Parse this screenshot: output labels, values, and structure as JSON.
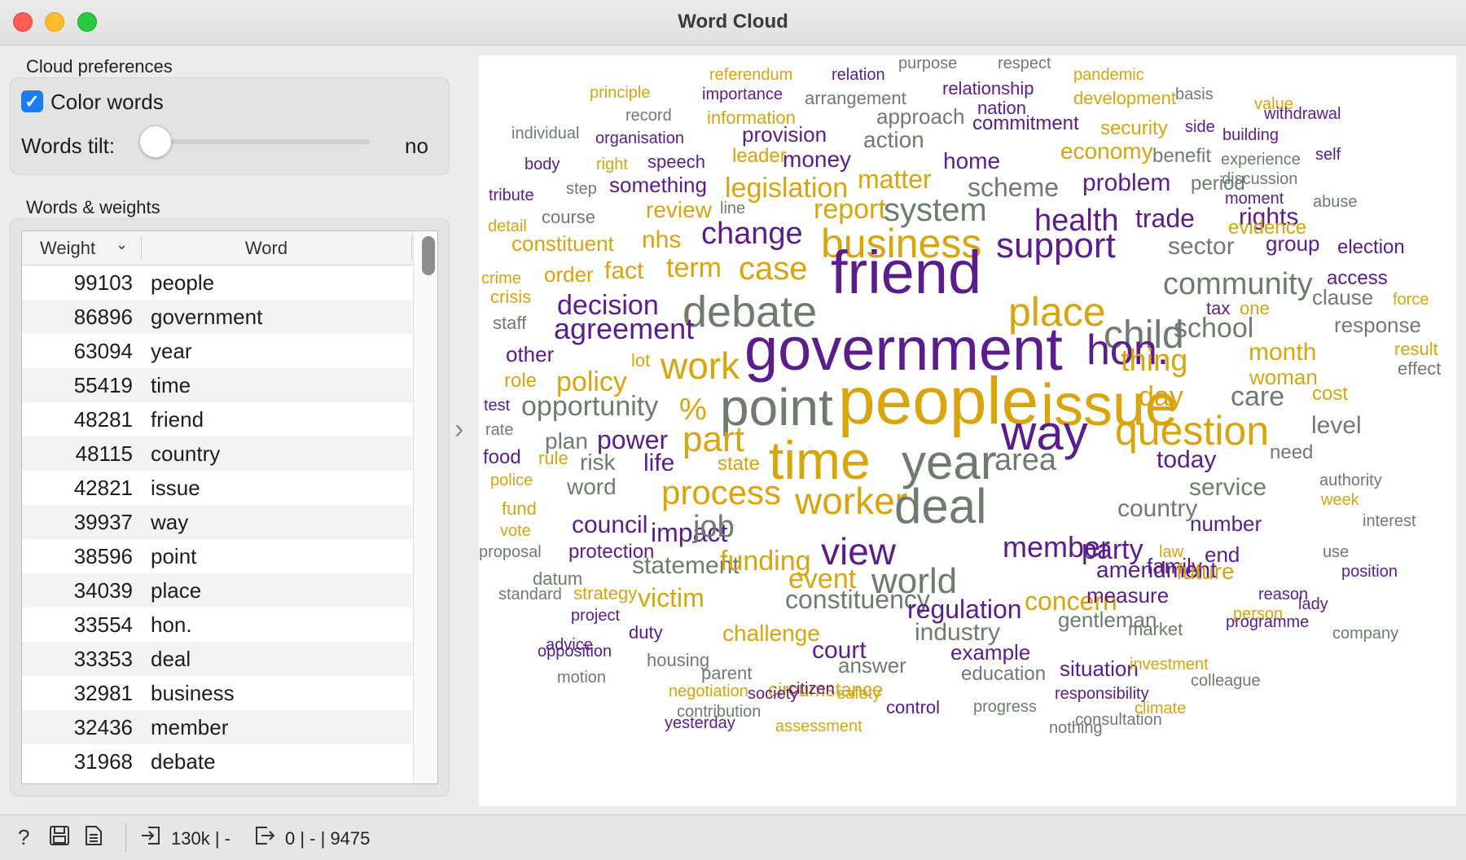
{
  "window": {
    "title": "Word Cloud"
  },
  "cloud_preferences": {
    "label": "Cloud preferences",
    "color_words": {
      "label": "Color words",
      "checked": true
    },
    "words_tilt": {
      "label": "Words tilt:",
      "value_label": "no",
      "level": 0
    }
  },
  "words_weights": {
    "label": "Words & weights",
    "columns": {
      "weight": "Weight",
      "word": "Word"
    },
    "rows": [
      {
        "weight": "99103",
        "word": "people"
      },
      {
        "weight": "86896",
        "word": "government"
      },
      {
        "weight": "63094",
        "word": "year"
      },
      {
        "weight": "55419",
        "word": "time"
      },
      {
        "weight": "48281",
        "word": "friend"
      },
      {
        "weight": "48115",
        "word": "country"
      },
      {
        "weight": "42821",
        "word": "issue"
      },
      {
        "weight": "39937",
        "word": "way"
      },
      {
        "weight": "38596",
        "word": "point"
      },
      {
        "weight": "34039",
        "word": "place"
      },
      {
        "weight": "33554",
        "word": "hon."
      },
      {
        "weight": "33353",
        "word": "deal"
      },
      {
        "weight": "32981",
        "word": "business"
      },
      {
        "weight": "32436",
        "word": "member"
      },
      {
        "weight": "31968",
        "word": "debate"
      }
    ]
  },
  "colors": {
    "gold": "#d9a40c",
    "purple": "#5b1c8d",
    "gray": "#6e7c6e"
  },
  "cloud_words": [
    {
      "t": "referendum",
      "c": "gold"
    },
    {
      "t": "relation",
      "c": "purple"
    },
    {
      "t": "purpose",
      "c": "gray"
    },
    {
      "t": "respect",
      "c": "gray"
    },
    {
      "t": "pandemic",
      "c": "gold"
    },
    {
      "t": "principle",
      "c": "gold"
    },
    {
      "t": "importance",
      "c": "purple"
    },
    {
      "t": "arrangement",
      "c": "gray"
    },
    {
      "t": "relationship",
      "c": "purple"
    },
    {
      "t": "development",
      "c": "gold"
    },
    {
      "t": "basis",
      "c": "gray"
    },
    {
      "t": "value",
      "c": "gold"
    },
    {
      "t": "record",
      "c": "gray"
    },
    {
      "t": "information",
      "c": "gold"
    },
    {
      "t": "approach",
      "c": "gray"
    },
    {
      "t": "nation",
      "c": "purple"
    },
    {
      "t": "withdrawal",
      "c": "purple"
    },
    {
      "t": "individual",
      "c": "gray"
    },
    {
      "t": "organisation",
      "c": "purple"
    },
    {
      "t": "provision",
      "c": "purple"
    },
    {
      "t": "action",
      "c": "gray"
    },
    {
      "t": "commitment",
      "c": "purple"
    },
    {
      "t": "security",
      "c": "gold"
    },
    {
      "t": "side",
      "c": "purple"
    },
    {
      "t": "building",
      "c": "purple"
    },
    {
      "t": "body",
      "c": "purple"
    },
    {
      "t": "right",
      "c": "gold"
    },
    {
      "t": "speech",
      "c": "purple"
    },
    {
      "t": "leader",
      "c": "gold"
    },
    {
      "t": "money",
      "c": "purple"
    },
    {
      "t": "home",
      "c": "purple"
    },
    {
      "t": "economy",
      "c": "gold"
    },
    {
      "t": "benefit",
      "c": "gray"
    },
    {
      "t": "experience",
      "c": "gray"
    },
    {
      "t": "self",
      "c": "purple"
    },
    {
      "t": "tribute",
      "c": "purple"
    },
    {
      "t": "step",
      "c": "gray"
    },
    {
      "t": "something",
      "c": "purple"
    },
    {
      "t": "legislation",
      "c": "gold"
    },
    {
      "t": "matter",
      "c": "gold"
    },
    {
      "t": "scheme",
      "c": "gray"
    },
    {
      "t": "problem",
      "c": "purple"
    },
    {
      "t": "period",
      "c": "gray"
    },
    {
      "t": "discussion",
      "c": "gray"
    },
    {
      "t": "line",
      "c": "gray"
    },
    {
      "t": "review",
      "c": "gold"
    },
    {
      "t": "report",
      "c": "gold"
    },
    {
      "t": "system",
      "c": "gray"
    },
    {
      "t": "moment",
      "c": "purple"
    },
    {
      "t": "abuse",
      "c": "gray"
    },
    {
      "t": "detail",
      "c": "gold"
    },
    {
      "t": "course",
      "c": "gray"
    },
    {
      "t": "change",
      "c": "purple"
    },
    {
      "t": "health",
      "c": "purple"
    },
    {
      "t": "trade",
      "c": "purple"
    },
    {
      "t": "rights",
      "c": "purple"
    },
    {
      "t": "evidence",
      "c": "gold"
    },
    {
      "t": "constituent",
      "c": "gold"
    },
    {
      "t": "nhs",
      "c": "gold"
    },
    {
      "t": "business",
      "c": "gold"
    },
    {
      "t": "support",
      "c": "purple"
    },
    {
      "t": "sector",
      "c": "gray"
    },
    {
      "t": "group",
      "c": "purple"
    },
    {
      "t": "election",
      "c": "purple"
    },
    {
      "t": "crime",
      "c": "gold"
    },
    {
      "t": "order",
      "c": "gold"
    },
    {
      "t": "fact",
      "c": "gold"
    },
    {
      "t": "term",
      "c": "gold"
    },
    {
      "t": "case",
      "c": "gold"
    },
    {
      "t": "friend",
      "c": "purple"
    },
    {
      "t": "community",
      "c": "gray"
    },
    {
      "t": "access",
      "c": "purple"
    },
    {
      "t": "crisis",
      "c": "gold"
    },
    {
      "t": "decision",
      "c": "purple"
    },
    {
      "t": "debate",
      "c": "gray"
    },
    {
      "t": "place",
      "c": "gold"
    },
    {
      "t": "clause",
      "c": "gray"
    },
    {
      "t": "force",
      "c": "gold"
    },
    {
      "t": "staff",
      "c": "gray"
    },
    {
      "t": "agreement",
      "c": "purple"
    },
    {
      "t": "child",
      "c": "gray"
    },
    {
      "t": "tax",
      "c": "purple"
    },
    {
      "t": "one",
      "c": "gold"
    },
    {
      "t": "school",
      "c": "gray"
    },
    {
      "t": "response",
      "c": "gray"
    },
    {
      "t": "other",
      "c": "purple"
    },
    {
      "t": "lot",
      "c": "gold"
    },
    {
      "t": "work",
      "c": "gold"
    },
    {
      "t": "government",
      "c": "purple"
    },
    {
      "t": "hon.",
      "c": "purple"
    },
    {
      "t": "thing",
      "c": "gold"
    },
    {
      "t": "month",
      "c": "gold"
    },
    {
      "t": "result",
      "c": "gold"
    },
    {
      "t": "effect",
      "c": "gray"
    },
    {
      "t": "role",
      "c": "gold"
    },
    {
      "t": "policy",
      "c": "gold"
    },
    {
      "t": "woman",
      "c": "gold"
    },
    {
      "t": "test",
      "c": "purple"
    },
    {
      "t": "opportunity",
      "c": "gray"
    },
    {
      "t": "%",
      "c": "gold"
    },
    {
      "t": "point",
      "c": "gray"
    },
    {
      "t": "people",
      "c": "gold"
    },
    {
      "t": "issue",
      "c": "gold"
    },
    {
      "t": "day",
      "c": "gold"
    },
    {
      "t": "care",
      "c": "gray"
    },
    {
      "t": "cost",
      "c": "gold"
    },
    {
      "t": "rate",
      "c": "gray"
    },
    {
      "t": "way",
      "c": "purple"
    },
    {
      "t": "question",
      "c": "gold"
    },
    {
      "t": "level",
      "c": "gray"
    },
    {
      "t": "plan",
      "c": "gray"
    },
    {
      "t": "power",
      "c": "purple"
    },
    {
      "t": "part",
      "c": "gold"
    },
    {
      "t": "time",
      "c": "gold"
    },
    {
      "t": "year",
      "c": "gray"
    },
    {
      "t": "food",
      "c": "purple"
    },
    {
      "t": "rule",
      "c": "gold"
    },
    {
      "t": "risk",
      "c": "gray"
    },
    {
      "t": "life",
      "c": "purple"
    },
    {
      "t": "state",
      "c": "gold"
    },
    {
      "t": "area",
      "c": "gray"
    },
    {
      "t": "today",
      "c": "purple"
    },
    {
      "t": "need",
      "c": "gray"
    },
    {
      "t": "police",
      "c": "gold"
    },
    {
      "t": "word",
      "c": "gray"
    },
    {
      "t": "process",
      "c": "gold"
    },
    {
      "t": "service",
      "c": "gray"
    },
    {
      "t": "authority",
      "c": "gray"
    },
    {
      "t": "fund",
      "c": "gold"
    },
    {
      "t": "worker",
      "c": "gold"
    },
    {
      "t": "deal",
      "c": "gray"
    },
    {
      "t": "country",
      "c": "gray"
    },
    {
      "t": "week",
      "c": "gold"
    },
    {
      "t": "vote",
      "c": "gold"
    },
    {
      "t": "council",
      "c": "purple"
    },
    {
      "t": "impact",
      "c": "purple"
    },
    {
      "t": "job",
      "c": "gray"
    },
    {
      "t": "number",
      "c": "purple"
    },
    {
      "t": "interest",
      "c": "gray"
    },
    {
      "t": "proposal",
      "c": "gray"
    },
    {
      "t": "protection",
      "c": "purple"
    },
    {
      "t": "view",
      "c": "purple"
    },
    {
      "t": "member",
      "c": "purple"
    },
    {
      "t": "law",
      "c": "gold"
    },
    {
      "t": "use",
      "c": "gray"
    },
    {
      "t": "datum",
      "c": "gray"
    },
    {
      "t": "statement",
      "c": "gray"
    },
    {
      "t": "funding",
      "c": "gold"
    },
    {
      "t": "party",
      "c": "purple"
    },
    {
      "t": "family",
      "c": "purple"
    },
    {
      "t": "end",
      "c": "purple"
    },
    {
      "t": "position",
      "c": "purple"
    },
    {
      "t": "event",
      "c": "gold"
    },
    {
      "t": "world",
      "c": "gray"
    },
    {
      "t": "amendment",
      "c": "purple"
    },
    {
      "t": "future",
      "c": "gold"
    },
    {
      "t": "standard",
      "c": "gray"
    },
    {
      "t": "strategy",
      "c": "gold"
    },
    {
      "t": "victim",
      "c": "gold"
    },
    {
      "t": "constituency",
      "c": "gray"
    },
    {
      "t": "regulation",
      "c": "purple"
    },
    {
      "t": "concern",
      "c": "gold"
    },
    {
      "t": "measure",
      "c": "purple"
    },
    {
      "t": "reason",
      "c": "purple"
    },
    {
      "t": "lady",
      "c": "purple"
    },
    {
      "t": "project",
      "c": "purple"
    },
    {
      "t": "person",
      "c": "gold"
    },
    {
      "t": "advice",
      "c": "purple"
    },
    {
      "t": "duty",
      "c": "purple"
    },
    {
      "t": "challenge",
      "c": "gold"
    },
    {
      "t": "industry",
      "c": "gray"
    },
    {
      "t": "gentleman",
      "c": "gray"
    },
    {
      "t": "market",
      "c": "gray"
    },
    {
      "t": "programme",
      "c": "purple"
    },
    {
      "t": "opposition",
      "c": "purple"
    },
    {
      "t": "housing",
      "c": "gray"
    },
    {
      "t": "court",
      "c": "purple"
    },
    {
      "t": "example",
      "c": "purple"
    },
    {
      "t": "company",
      "c": "gray"
    },
    {
      "t": "parent",
      "c": "gray"
    },
    {
      "t": "answer",
      "c": "gray"
    },
    {
      "t": "situation",
      "c": "purple"
    },
    {
      "t": "investment",
      "c": "gold"
    },
    {
      "t": "motion",
      "c": "gray"
    },
    {
      "t": "circumstance",
      "c": "gold"
    },
    {
      "t": "education",
      "c": "gray"
    },
    {
      "t": "colleague",
      "c": "gray"
    },
    {
      "t": "negotiation",
      "c": "gold"
    },
    {
      "t": "society",
      "c": "purple"
    },
    {
      "t": "citizen",
      "c": "purple"
    },
    {
      "t": "safety",
      "c": "gold"
    },
    {
      "t": "responsibility",
      "c": "purple"
    },
    {
      "t": "contribution",
      "c": "gray"
    },
    {
      "t": "control",
      "c": "purple"
    },
    {
      "t": "progress",
      "c": "gray"
    },
    {
      "t": "climate",
      "c": "gold"
    },
    {
      "t": "yesterday",
      "c": "purple"
    },
    {
      "t": "assessment",
      "c": "gold"
    },
    {
      "t": "consultation",
      "c": "gray"
    },
    {
      "t": "nothing",
      "c": "gray"
    }
  ],
  "statusbar": {
    "input_summary": "130k | -",
    "output_summary": "0 | - | 9475",
    "icons": [
      "help-icon",
      "save-icon",
      "report-icon",
      "input-icon",
      "output-icon"
    ]
  }
}
